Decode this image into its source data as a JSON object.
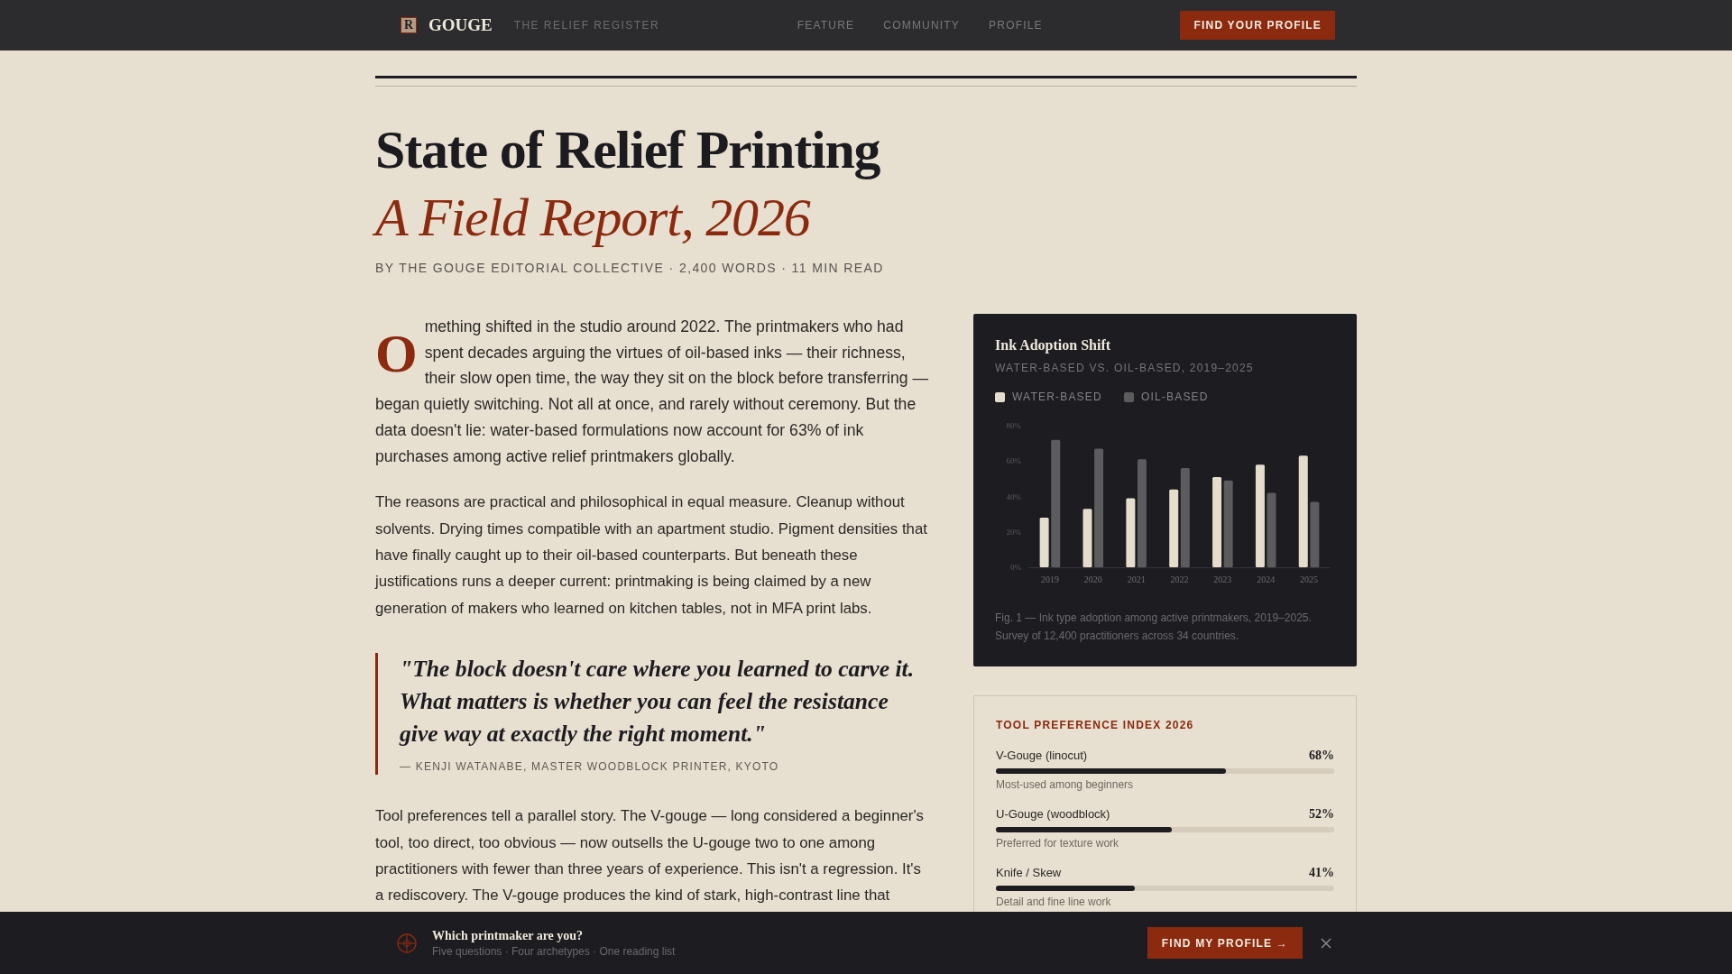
{
  "header": {
    "logo_mark": "R",
    "brand": "GOUGE",
    "tagline": "THE RELIEF REGISTER",
    "nav": [
      {
        "label": "FEATURE"
      },
      {
        "label": "COMMUNITY"
      },
      {
        "label": "PROFILE"
      }
    ],
    "cta": "FIND YOUR PROFILE"
  },
  "article": {
    "title": "State of Relief Printing",
    "subtitle": "A Field Report, 2026",
    "byline": "BY THE GOUGE EDITORIAL COLLECTIVE · 2,400 WORDS · 11 MIN READ",
    "body": [
      {
        "kind": "dropcap_paragraph",
        "drop_cap": "O",
        "text": "mething shifted in the studio around 2022. The printmakers who had spent decades arguing the virtues of oil-based inks — their richness, their slow open time, the way they sit on the block before transferring — began quietly switching. Not all at once, and rarely without ceremony. But the data doesn't lie: water-based formulations now account for 63% of ink purchases among active relief printmakers globally."
      },
      {
        "kind": "paragraph",
        "text": "The reasons are practical and philosophical in equal measure. Cleanup without solvents. Drying times compatible with an apartment studio. Pigment densities that have finally caught up to their oil-based counterparts. But beneath these justifications runs a deeper current: printmaking is being claimed by a new generation of makers who learned on kitchen tables, not in MFA print labs."
      },
      {
        "kind": "quote",
        "text": "\"The block doesn't care where you learned to carve it. What matters is whether you can feel the resistance give way at exactly the right moment.\"",
        "attribution": "— KENJI WATANABE, MASTER WOODBLOCK PRINTER, KYOTO"
      },
      {
        "kind": "paragraph",
        "text": "Tool preferences tell a parallel story. The V-gouge — long considered a beginner's tool, too direct, too obvious — now outsells the U-gouge two to one among practitioners with fewer than three years of experience. This isn't a regression. It's a rediscovery. The V-gouge produces the kind of stark, high-contrast line that"
      }
    ]
  },
  "chart_panel": {
    "chart_data": {
      "type": "bar",
      "title": "Ink Adoption Shift",
      "subtitle": "WATER-BASED VS. OIL-BASED, 2019–2025",
      "categories": [
        "2019",
        "2020",
        "2021",
        "2022",
        "2023",
        "2024",
        "2025"
      ],
      "series": [
        {
          "name": "WATER-BASED",
          "color": "#e5ddcc",
          "values": [
            28,
            33,
            39,
            44,
            51,
            58,
            63
          ]
        },
        {
          "name": "OIL-BASED",
          "color": "#5c5b5e",
          "values": [
            72,
            67,
            61,
            56,
            49,
            42,
            37
          ]
        }
      ],
      "ylim": [
        0,
        80
      ],
      "yticks": [
        {
          "value": 0,
          "label": "0%"
        },
        {
          "value": 20,
          "label": "20%"
        },
        {
          "value": 40,
          "label": "40%"
        },
        {
          "value": 60,
          "label": "60%"
        },
        {
          "value": 80,
          "label": "80%"
        }
      ],
      "legend": "top"
    },
    "caption": "Fig. 1 — Ink type adoption among active printmakers, 2019–2025. Survey of 12,400 practitioners across 34 countries."
  },
  "tool_panel": {
    "title": "TOOL PREFERENCE INDEX 2026",
    "items": [
      {
        "label": "V-Gouge (linocut)",
        "value": "68%",
        "level": 0.68,
        "note": "Most-used among beginners"
      },
      {
        "label": "U-Gouge (woodblock)",
        "value": "52%",
        "level": 0.52,
        "note": "Preferred for texture work"
      },
      {
        "label": "Knife / Skew",
        "value": "41%",
        "level": 0.41,
        "note": "Detail and fine line work"
      }
    ]
  },
  "quiz_bar": {
    "title": "Which printmaker are you?",
    "subtitle": "Five questions · Four archetypes · One reading list",
    "cta": "FIND MY PROFILE →"
  }
}
